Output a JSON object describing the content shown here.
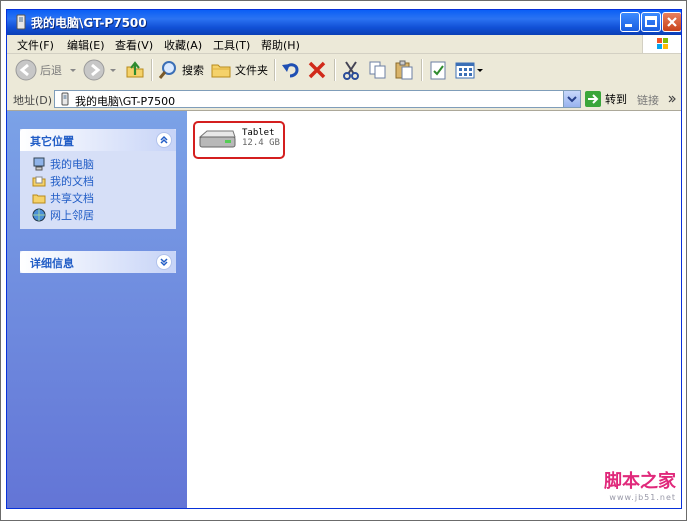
{
  "window": {
    "title": "我的电脑\\GT-P7500"
  },
  "menu": [
    "文件(F)",
    "编辑(E)",
    "查看(V)",
    "收藏(A)",
    "工具(T)",
    "帮助(H)"
  ],
  "toolbar": {
    "back_label": "后退",
    "search_label": "搜索",
    "folders_label": "文件夹"
  },
  "address": {
    "label": "地址(D)",
    "value": "我的电脑\\GT-P7500",
    "go_label": "转到",
    "links_label": "链接"
  },
  "sidebar": {
    "other_places": {
      "title": "其它位置",
      "items": [
        {
          "label": "我的电脑",
          "icon": "computer-icon"
        },
        {
          "label": "我的文档",
          "icon": "folder-icon"
        },
        {
          "label": "共享文档",
          "icon": "folder-icon"
        },
        {
          "label": "网上邻居",
          "icon": "network-icon"
        }
      ]
    },
    "details": {
      "title": "详细信息"
    }
  },
  "content": {
    "drive": {
      "name": "Tablet",
      "size": "12.4 GB",
      "icon": "removable-drive-icon"
    }
  },
  "watermark": {
    "text": "脚本之家",
    "url": "www.jb51.net"
  },
  "colors": {
    "titlebar": "#0A5FF6",
    "sidebar": "#7BA2E7",
    "link": "#215DC6",
    "highlight": "#D41F1F",
    "watermark": "#E0297B"
  }
}
